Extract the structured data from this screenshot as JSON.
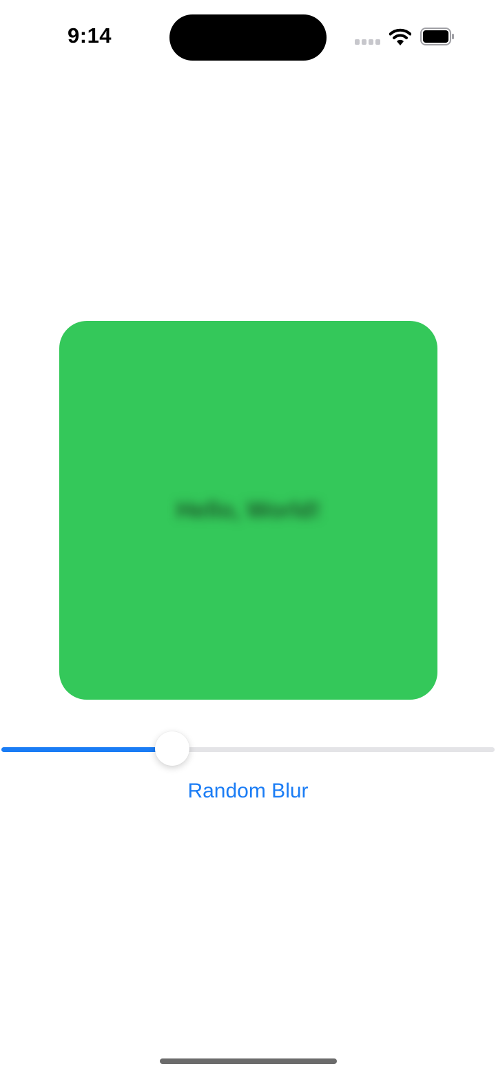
{
  "status_bar": {
    "time": "9:14"
  },
  "icons": {
    "signal": "cellular-signal-icon",
    "wifi": "wifi-icon",
    "battery": "battery-icon"
  },
  "card": {
    "blurred_text": "Hello, World!"
  },
  "slider": {
    "fraction": 0.346
  },
  "button": {
    "label": "Random Blur"
  },
  "colors": {
    "accent": "#1a7cf5",
    "card": "#34c85a",
    "track": "#e4e4e7"
  }
}
